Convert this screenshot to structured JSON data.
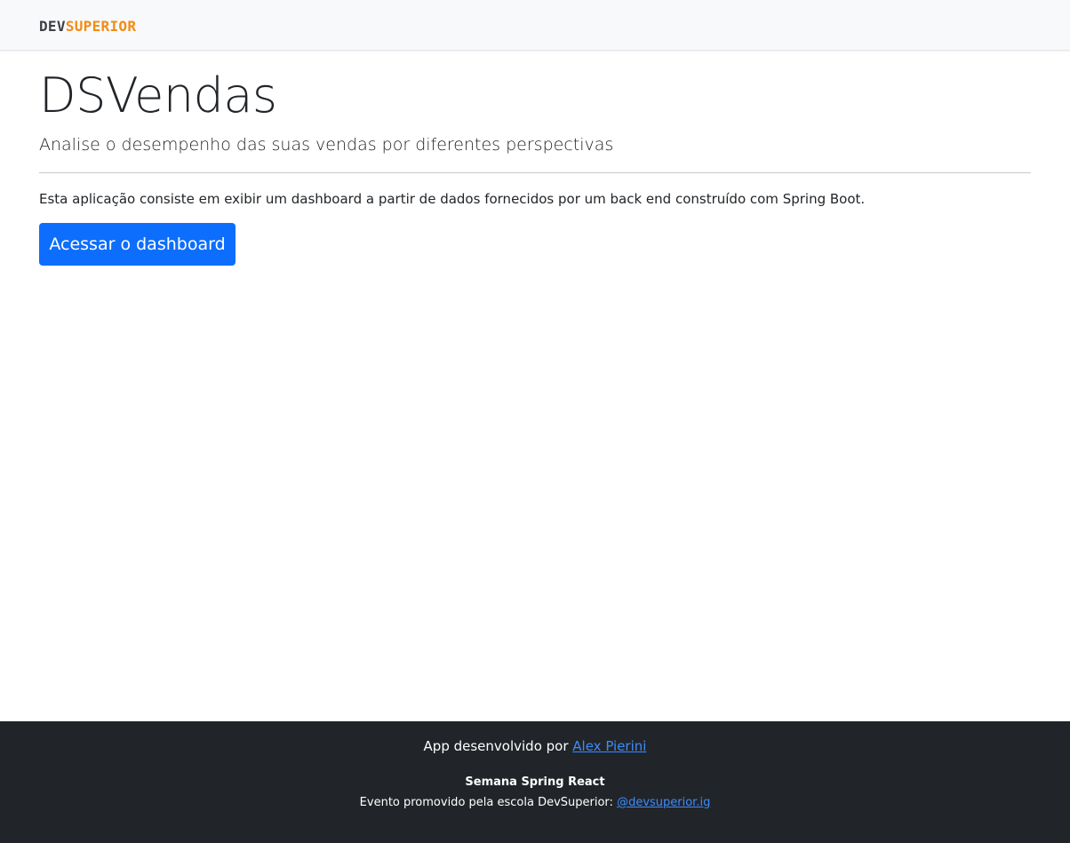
{
  "navbar": {
    "logo": {
      "part1": "DEV",
      "part2": "SUPERIOR"
    }
  },
  "hero": {
    "title": "DSVendas",
    "lead": "Analise o desempenho das suas vendas por diferentes perspectivas",
    "description": "Esta aplicação consiste em exibir um dashboard a partir de dados fornecidos por um back end construído com Spring Boot.",
    "button_label": "Acessar o dashboard"
  },
  "footer": {
    "line1_prefix": "App desenvolvido por ",
    "author_link": "Alex Pierini",
    "event_title": "Semana Spring React",
    "event_prefix": "Evento promovido pela escola DevSuperior: ",
    "instagram_link": "@devsuperior.ig"
  },
  "colors": {
    "primary": "#0d6efd",
    "logo_dark": "#3c3f44",
    "logo_accent": "#f38b13",
    "footer_bg": "#212529",
    "navbar_bg": "#f8f9fa"
  }
}
